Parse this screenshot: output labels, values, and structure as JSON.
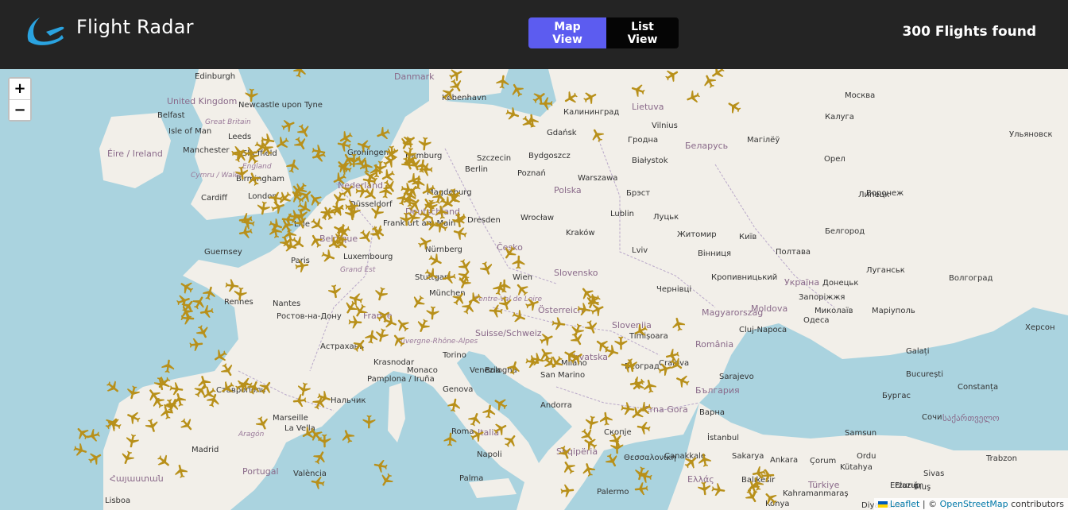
{
  "header": {
    "title": "Flight Radar",
    "map_view_label": "Map View",
    "list_view_label": "List View",
    "flights_count": "300 Flights found"
  },
  "map": {
    "zoom_in": "+",
    "zoom_out": "−",
    "attribution_leaflet": "Leaflet",
    "attribution_sep": " | © ",
    "attribution_osm": "OpenStreetMap",
    "attribution_suffix": " contributors",
    "labels": [
      {
        "text": "Edinburgh",
        "cls": "city"
      },
      {
        "text": "Danmark",
        "cls": "country"
      },
      {
        "text": "København",
        "cls": "city"
      },
      {
        "text": "Lietuva",
        "cls": "country"
      },
      {
        "text": "Москва",
        "cls": "city"
      },
      {
        "text": "United Kingdom",
        "cls": "country"
      },
      {
        "text": "Newcastle upon Tyne",
        "cls": "city"
      },
      {
        "text": "Belfast",
        "cls": "city"
      },
      {
        "text": "Great Britain",
        "cls": "region"
      },
      {
        "text": "Калининград",
        "cls": "city"
      },
      {
        "text": "Vilnius",
        "cls": "city"
      },
      {
        "text": "Калуга",
        "cls": "city"
      },
      {
        "text": "Ульяновск",
        "cls": "city"
      },
      {
        "text": "Isle of Man",
        "cls": "city"
      },
      {
        "text": "Leeds",
        "cls": "city"
      },
      {
        "text": "Gdańsk",
        "cls": "city"
      },
      {
        "text": "Гродна",
        "cls": "city"
      },
      {
        "text": "Беларусь",
        "cls": "country"
      },
      {
        "text": "Магілёў",
        "cls": "city"
      },
      {
        "text": "Éire / Ireland",
        "cls": "country"
      },
      {
        "text": "Manchester",
        "cls": "city"
      },
      {
        "text": "Sheffield",
        "cls": "city"
      },
      {
        "text": "Groningen",
        "cls": "city"
      },
      {
        "text": "Hamburg",
        "cls": "city"
      },
      {
        "text": "Szczecin",
        "cls": "city"
      },
      {
        "text": "Bydgoszcz",
        "cls": "city"
      },
      {
        "text": "Białystok",
        "cls": "city"
      },
      {
        "text": "Орел",
        "cls": "city"
      },
      {
        "text": "England",
        "cls": "region"
      },
      {
        "text": "Birmingham",
        "cls": "city"
      },
      {
        "text": "Berlin",
        "cls": "city"
      },
      {
        "text": "Poznań",
        "cls": "city"
      },
      {
        "text": "Warszawa",
        "cls": "city"
      },
      {
        "text": "Липецк",
        "cls": "city"
      },
      {
        "text": "Cymru / Wales",
        "cls": "region"
      },
      {
        "text": "Cardiff",
        "cls": "city"
      },
      {
        "text": "London",
        "cls": "city"
      },
      {
        "text": "Nederland",
        "cls": "country"
      },
      {
        "text": "Magdeburg",
        "cls": "city"
      },
      {
        "text": "Polska",
        "cls": "country"
      },
      {
        "text": "Брэст",
        "cls": "city"
      },
      {
        "text": "Воронеж",
        "cls": "city"
      },
      {
        "text": "Düsseldorf",
        "cls": "city"
      },
      {
        "text": "Deutschland",
        "cls": "country"
      },
      {
        "text": "Dresden",
        "cls": "city"
      },
      {
        "text": "Wrocław",
        "cls": "city"
      },
      {
        "text": "Lublin",
        "cls": "city"
      },
      {
        "text": "Луцьк",
        "cls": "city"
      },
      {
        "text": "Lille",
        "cls": "city"
      },
      {
        "text": "Belgique",
        "cls": "country"
      },
      {
        "text": "Frankfurt am Main",
        "cls": "city"
      },
      {
        "text": "Kraków",
        "cls": "city"
      },
      {
        "text": "Житомир",
        "cls": "city"
      },
      {
        "text": "Київ",
        "cls": "city"
      },
      {
        "text": "Белгород",
        "cls": "city"
      },
      {
        "text": "Guernsey",
        "cls": "city"
      },
      {
        "text": "Paris",
        "cls": "city"
      },
      {
        "text": "Luxembourg",
        "cls": "city"
      },
      {
        "text": "Nürnberg",
        "cls": "city"
      },
      {
        "text": "Česko",
        "cls": "country"
      },
      {
        "text": "Lviv",
        "cls": "city"
      },
      {
        "text": "Вінниця",
        "cls": "city"
      },
      {
        "text": "Полтава",
        "cls": "city"
      },
      {
        "text": "Луганськ",
        "cls": "city"
      },
      {
        "text": "Grand Est",
        "cls": "region"
      },
      {
        "text": "Stuttgart",
        "cls": "city"
      },
      {
        "text": "Wien",
        "cls": "city"
      },
      {
        "text": "Slovensko",
        "cls": "country"
      },
      {
        "text": "Кропивницький",
        "cls": "city"
      },
      {
        "text": "Україна",
        "cls": "country"
      },
      {
        "text": "Донецьк",
        "cls": "city"
      },
      {
        "text": "Волгоград",
        "cls": "city"
      },
      {
        "text": "Rennes",
        "cls": "city"
      },
      {
        "text": "München",
        "cls": "city"
      },
      {
        "text": "Чернівці",
        "cls": "city"
      },
      {
        "text": "Запоріжжя",
        "cls": "city"
      },
      {
        "text": "Nantes",
        "cls": "city"
      },
      {
        "text": "Centre-Val de Loire",
        "cls": "region"
      },
      {
        "text": "Österreich",
        "cls": "country"
      },
      {
        "text": "Magyarország",
        "cls": "country"
      },
      {
        "text": "Moldova",
        "cls": "country"
      },
      {
        "text": "Миколаїв",
        "cls": "city"
      },
      {
        "text": "Маріуполь",
        "cls": "city"
      },
      {
        "text": "Ростов-на-Дону",
        "cls": "city"
      },
      {
        "text": "France",
        "cls": "country"
      },
      {
        "text": "Suisse/Schweiz",
        "cls": "country"
      },
      {
        "text": "Slovenija",
        "cls": "country"
      },
      {
        "text": "Cluj-Napoca",
        "cls": "city"
      },
      {
        "text": "Одеса",
        "cls": "city"
      },
      {
        "text": "Херсон",
        "cls": "city"
      },
      {
        "text": "Астрахань",
        "cls": "city"
      },
      {
        "text": "Auvergne-Rhône-Alpes",
        "cls": "region"
      },
      {
        "text": "Milano",
        "cls": "city"
      },
      {
        "text": "Timișoara",
        "cls": "city"
      },
      {
        "text": "România",
        "cls": "country"
      },
      {
        "text": "Galați",
        "cls": "city"
      },
      {
        "text": "Krasnodar",
        "cls": "city"
      },
      {
        "text": "Torino",
        "cls": "city"
      },
      {
        "text": "Venezia",
        "cls": "city"
      },
      {
        "text": "Bologna",
        "cls": "city"
      },
      {
        "text": "Hrvatska",
        "cls": "country"
      },
      {
        "text": "Београд",
        "cls": "city"
      },
      {
        "text": "Craiova",
        "cls": "city"
      },
      {
        "text": "București",
        "cls": "city"
      },
      {
        "text": "Ставрополь",
        "cls": "city"
      },
      {
        "text": "Pamplona / Iruña",
        "cls": "city"
      },
      {
        "text": "Monaco",
        "cls": "city"
      },
      {
        "text": "Genova",
        "cls": "city"
      },
      {
        "text": "San Marino",
        "cls": "city"
      },
      {
        "text": "Sarajevo",
        "cls": "city"
      },
      {
        "text": "Constanța",
        "cls": "city"
      },
      {
        "text": "Нальчик",
        "cls": "city"
      },
      {
        "text": "Marseille",
        "cls": "city"
      },
      {
        "text": "Andorra",
        "cls": "city"
      },
      {
        "text": "Crna Gora",
        "cls": "country"
      },
      {
        "text": "България",
        "cls": "country"
      },
      {
        "text": "Варна",
        "cls": "city"
      },
      {
        "text": "Бургас",
        "cls": "city"
      },
      {
        "text": "Сочи",
        "cls": "city"
      },
      {
        "text": "Aragón",
        "cls": "region"
      },
      {
        "text": "La Vella",
        "cls": "city"
      },
      {
        "text": "Roma",
        "cls": "city"
      },
      {
        "text": "Italia",
        "cls": "country"
      },
      {
        "text": "Скопје",
        "cls": "city"
      },
      {
        "text": "İstanbul",
        "cls": "city"
      },
      {
        "text": "Samsun",
        "cls": "city"
      },
      {
        "text": "საქართველო",
        "cls": "country"
      },
      {
        "text": "Madrid",
        "cls": "city"
      },
      {
        "text": "Napoli",
        "cls": "city"
      },
      {
        "text": "Shqipëria",
        "cls": "country"
      },
      {
        "text": "Θεσσαλονίκη",
        "cls": "city"
      },
      {
        "text": "Çanakkale",
        "cls": "city"
      },
      {
        "text": "Sakarya",
        "cls": "city"
      },
      {
        "text": "Ankara",
        "cls": "city"
      },
      {
        "text": "Çorum",
        "cls": "city"
      },
      {
        "text": "Ordu",
        "cls": "city"
      },
      {
        "text": "Trabzon",
        "cls": "city"
      },
      {
        "text": "Հայաստան",
        "cls": "country"
      },
      {
        "text": "Portugal",
        "cls": "country"
      },
      {
        "text": "València",
        "cls": "city"
      },
      {
        "text": "Palma",
        "cls": "city"
      },
      {
        "text": "Palermo",
        "cls": "city"
      },
      {
        "text": "Ελλάς",
        "cls": "country"
      },
      {
        "text": "Balıkesir",
        "cls": "city"
      },
      {
        "text": "Kütahya",
        "cls": "city"
      },
      {
        "text": "Sivas",
        "cls": "city"
      },
      {
        "text": "Erzurum",
        "cls": "city"
      },
      {
        "text": "Lisboa",
        "cls": "city"
      },
      {
        "text": "Türkiye",
        "cls": "country"
      },
      {
        "text": "Elazığ",
        "cls": "city"
      },
      {
        "text": "Muş",
        "cls": "city"
      },
      {
        "text": "Konya",
        "cls": "city"
      },
      {
        "text": "Kahramanmaraş",
        "cls": "city"
      },
      {
        "text": "Diyarbakır",
        "cls": "city"
      }
    ]
  },
  "colors": {
    "accent": "#5c5cf0",
    "plane": "#b8901a",
    "header_bg": "#242424",
    "water": "#aad3df",
    "land": "#f2efe9"
  }
}
